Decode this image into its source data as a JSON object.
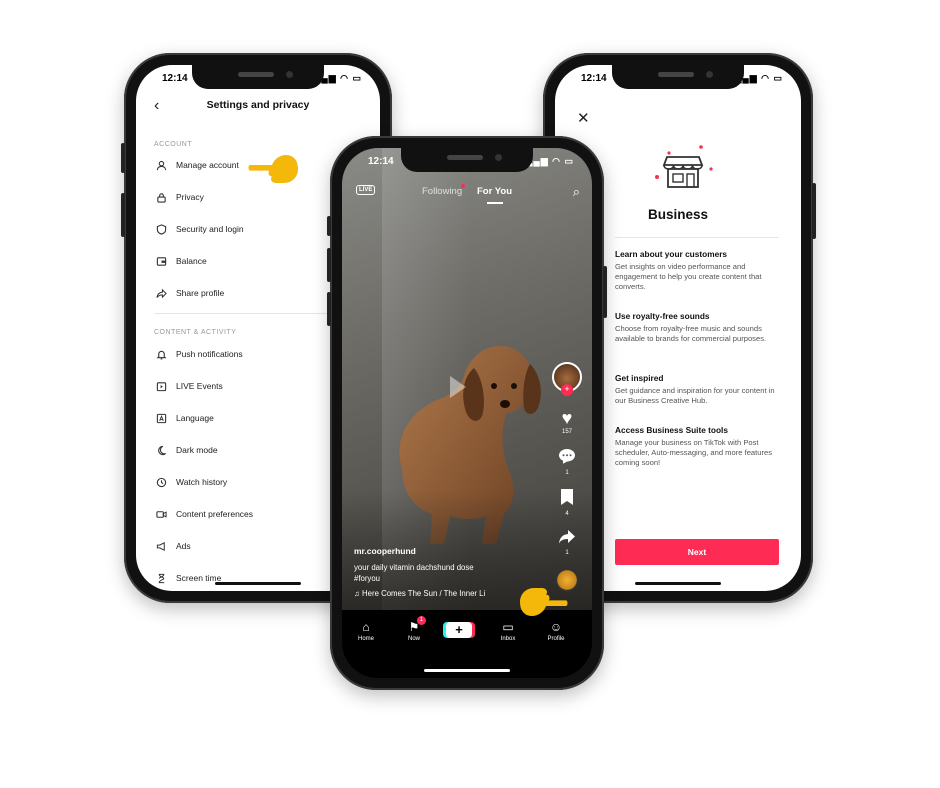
{
  "colors": {
    "accent": "#fe2c55",
    "pointer": "#f3b80a",
    "cyan": "#25f4ee"
  },
  "left_phone": {
    "status_time": "12:14",
    "header_title": "Settings and privacy",
    "section_account": "ACCOUNT",
    "account_items": [
      {
        "label": "Manage account",
        "icon": "person-icon"
      },
      {
        "label": "Privacy",
        "icon": "lock-icon"
      },
      {
        "label": "Security and login",
        "icon": "shield-icon"
      },
      {
        "label": "Balance",
        "icon": "wallet-icon"
      },
      {
        "label": "Share profile",
        "icon": "share-icon"
      }
    ],
    "section_content": "CONTENT & ACTIVITY",
    "content_items": [
      {
        "label": "Push notifications",
        "icon": "bell-icon"
      },
      {
        "label": "LIVE Events",
        "icon": "calendar-icon"
      },
      {
        "label": "Language",
        "icon": "language-icon"
      },
      {
        "label": "Dark mode",
        "icon": "moon-icon"
      },
      {
        "label": "Watch history",
        "icon": "history-icon"
      },
      {
        "label": "Content preferences",
        "icon": "video-icon"
      },
      {
        "label": "Ads",
        "icon": "megaphone-icon"
      },
      {
        "label": "Screen time",
        "icon": "hourglass-icon"
      }
    ]
  },
  "center_phone": {
    "status_time": "12:14",
    "live_label": "LIVE",
    "tab_following": "Following",
    "tab_foryou": "For You",
    "likes": "157",
    "comments": "1",
    "saves": "4",
    "shares": "1",
    "username": "mr.cooperhund",
    "description": "your daily vitamin dachshund dose",
    "hashtag": "#foryou",
    "music": "Here Comes The Sun / The Inner Li",
    "tabs": [
      {
        "label": "Home",
        "icon": "home-icon"
      },
      {
        "label": "Now",
        "icon": "now-icon",
        "badge": "1"
      },
      {
        "label": "Inbox",
        "icon": "inbox-icon"
      },
      {
        "label": "Profile",
        "icon": "profile-icon"
      }
    ]
  },
  "right_phone": {
    "status_time": "12:14",
    "title": "Business",
    "features": [
      {
        "title": "Learn about your customers",
        "body": "Get insights on video performance and engagement to help you create content that converts."
      },
      {
        "title": "Use royalty-free sounds",
        "body": "Choose from royalty-free music and sounds available to brands for commercial purposes."
      },
      {
        "title": "Get inspired",
        "body": "Get guidance and inspiration for your content in our Business Creative Hub."
      },
      {
        "title": "Access Business Suite tools",
        "body": "Manage your business on TikTok with Post scheduler, Auto-messaging, and more features coming soon!"
      }
    ],
    "next_label": "Next"
  }
}
